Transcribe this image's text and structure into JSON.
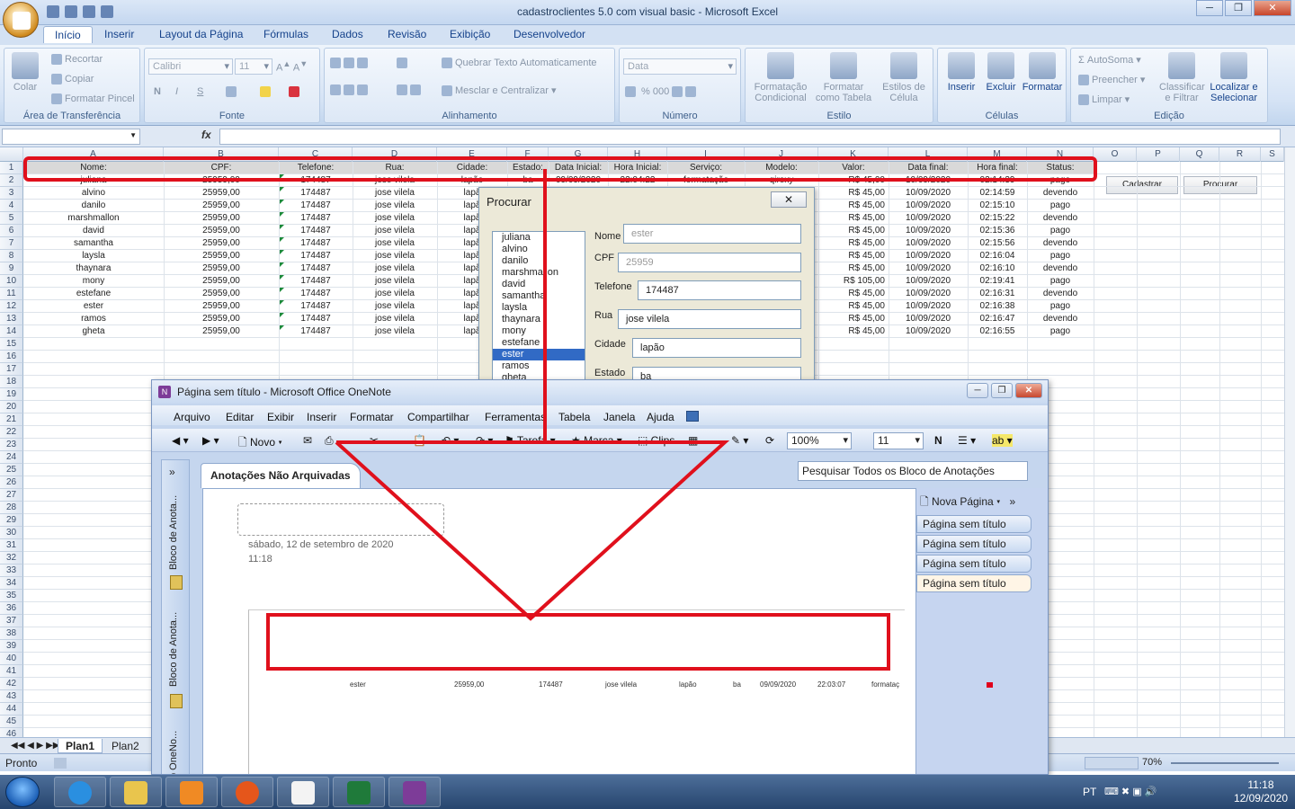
{
  "excel": {
    "window_title": "cadastroclientes 5.0 com visual basic - Microsoft Excel",
    "orb_letter": "",
    "window_buttons": [
      "─",
      "❐",
      "✕"
    ],
    "tabs": [
      "Início",
      "Inserir",
      "Layout da Página",
      "Fórmulas",
      "Dados",
      "Revisão",
      "Exibição",
      "Desenvolvedor"
    ],
    "ribbon": {
      "clipboard": {
        "label": "Área de Transferência",
        "paste": "Colar",
        "cut": "Recortar",
        "copy": "Copiar",
        "format_painter": "Formatar Pincel"
      },
      "font": {
        "label": "Fonte",
        "name": "Calibri",
        "size": "11",
        "bold": "N",
        "italic": "I",
        "underline": "S"
      },
      "alignment": {
        "label": "Alinhamento",
        "wrap": "Quebrar Texto Automaticamente",
        "merge": "Mesclar e Centralizar"
      },
      "number": {
        "label": "Número",
        "format": "Data"
      },
      "styles": {
        "label": "Estilo",
        "conditional": "Formatação Condicional",
        "as_table": "Formatar como Tabela",
        "cell_styles": "Estilos de Célula"
      },
      "cells": {
        "label": "Células",
        "insert": "Inserir",
        "delete": "Excluir",
        "format": "Formatar"
      },
      "editing": {
        "label": "Edição",
        "autosum": "AutoSoma",
        "fill": "Preencher",
        "clear": "Limpar",
        "sort": "Classificar e Filtrar",
        "find": "Localizar e Selecionar"
      }
    },
    "formula_bar": {
      "fx": "fx",
      "name_box": "",
      "content": ""
    },
    "columns": [
      "A",
      "B",
      "C",
      "D",
      "E",
      "F",
      "G",
      "H",
      "I",
      "J",
      "K",
      "L",
      "M",
      "N",
      "O",
      "P",
      "Q",
      "R",
      "S"
    ],
    "row_numbers": [
      "1",
      "2",
      "3",
      "4",
      "5",
      "6",
      "7",
      "8",
      "9",
      "10",
      "11",
      "12",
      "13",
      "14",
      "15",
      "16",
      "17",
      "18",
      "19",
      "20",
      "21",
      "22",
      "23",
      "24",
      "25",
      "26",
      "27",
      "28",
      "29",
      "30",
      "31",
      "32",
      "33",
      "34",
      "35",
      "36",
      "37",
      "38",
      "39",
      "40",
      "41",
      "42",
      "43",
      "44",
      "45",
      "46"
    ],
    "headers": [
      "Nome:",
      "CPF:",
      "Telefone:",
      "Rua:",
      "Cidade:",
      "Estado:",
      "Data Inicial:",
      "Hora Inicial:",
      "Serviço:",
      "Modelo:",
      "Valor:",
      "Data final:",
      "Hora final:",
      "Status:"
    ],
    "rows": [
      {
        "nome": "juliana",
        "cpf": "25959,00",
        "tel": "174487",
        "rua": "jose vilela",
        "cidade": "lapão",
        "estado": "ba",
        "dini": "09/09/2020",
        "hini": "22:04:22",
        "serv": "formatação",
        "mod": "qirexy",
        "valor": "R$ 45,00",
        "dfim": "10/09/2020",
        "hfim": "02:14:39",
        "status": "pago"
      },
      {
        "nome": "alvino",
        "cpf": "25959,00",
        "tel": "174487",
        "rua": "jose vilela",
        "cidade": "lapã",
        "estado": "",
        "dini": "",
        "hini": "",
        "serv": "",
        "mod": "",
        "valor": "R$ 45,00",
        "dfim": "10/09/2020",
        "hfim": "02:14:59",
        "status": "devendo"
      },
      {
        "nome": "danilo",
        "cpf": "25959,00",
        "tel": "174487",
        "rua": "jose vilela",
        "cidade": "lapã",
        "estado": "",
        "dini": "",
        "hini": "",
        "serv": "",
        "mod": "",
        "valor": "R$ 45,00",
        "dfim": "10/09/2020",
        "hfim": "02:15:10",
        "status": "pago"
      },
      {
        "nome": "marshmallon",
        "cpf": "25959,00",
        "tel": "174487",
        "rua": "jose vilela",
        "cidade": "lapã",
        "estado": "",
        "dini": "",
        "hini": "",
        "serv": "",
        "mod": "",
        "valor": "R$ 45,00",
        "dfim": "10/09/2020",
        "hfim": "02:15:22",
        "status": "devendo"
      },
      {
        "nome": "david",
        "cpf": "25959,00",
        "tel": "174487",
        "rua": "jose vilela",
        "cidade": "lapã",
        "estado": "",
        "dini": "",
        "hini": "",
        "serv": "",
        "mod": "",
        "valor": "R$ 45,00",
        "dfim": "10/09/2020",
        "hfim": "02:15:36",
        "status": "pago"
      },
      {
        "nome": "samantha",
        "cpf": "25959,00",
        "tel": "174487",
        "rua": "jose vilela",
        "cidade": "lapã",
        "estado": "",
        "dini": "",
        "hini": "",
        "serv": "",
        "mod": "",
        "valor": "R$ 45,00",
        "dfim": "10/09/2020",
        "hfim": "02:15:56",
        "status": "devendo"
      },
      {
        "nome": "laysla",
        "cpf": "25959,00",
        "tel": "174487",
        "rua": "jose vilela",
        "cidade": "lapã",
        "estado": "",
        "dini": "",
        "hini": "",
        "serv": "",
        "mod": "",
        "valor": "R$ 45,00",
        "dfim": "10/09/2020",
        "hfim": "02:16:04",
        "status": "pago"
      },
      {
        "nome": "thaynara",
        "cpf": "25959,00",
        "tel": "174487",
        "rua": "jose vilela",
        "cidade": "lapã",
        "estado": "",
        "dini": "",
        "hini": "",
        "serv": "",
        "mod": "",
        "valor": "R$ 45,00",
        "dfim": "10/09/2020",
        "hfim": "02:16:10",
        "status": "devendo"
      },
      {
        "nome": "mony",
        "cpf": "25959,00",
        "tel": "174487",
        "rua": "jose vilela",
        "cidade": "lapã",
        "estado": "",
        "dini": "",
        "hini": "",
        "serv": "",
        "mod": "",
        "valor": "R$ 105,00",
        "dfim": "10/09/2020",
        "hfim": "02:19:41",
        "status": "pago"
      },
      {
        "nome": "estefane",
        "cpf": "25959,00",
        "tel": "174487",
        "rua": "jose vilela",
        "cidade": "lapã",
        "estado": "",
        "dini": "",
        "hini": "",
        "serv": "",
        "mod": "",
        "valor": "R$ 45,00",
        "dfim": "10/09/2020",
        "hfim": "02:16:31",
        "status": "devendo"
      },
      {
        "nome": "ester",
        "cpf": "25959,00",
        "tel": "174487",
        "rua": "jose vilela",
        "cidade": "lapã",
        "estado": "",
        "dini": "",
        "hini": "",
        "serv": "",
        "mod": "",
        "valor": "R$ 45,00",
        "dfim": "10/09/2020",
        "hfim": "02:16:38",
        "status": "pago"
      },
      {
        "nome": "ramos",
        "cpf": "25959,00",
        "tel": "174487",
        "rua": "jose vilela",
        "cidade": "lapã",
        "estado": "",
        "dini": "",
        "hini": "",
        "serv": "",
        "mod": "",
        "valor": "R$ 45,00",
        "dfim": "10/09/2020",
        "hfim": "02:16:47",
        "status": "devendo"
      },
      {
        "nome": "gheta",
        "cpf": "25959,00",
        "tel": "174487",
        "rua": "jose vilela",
        "cidade": "lapã",
        "estado": "",
        "dini": "",
        "hini": "",
        "serv": "",
        "mod": "",
        "valor": "R$ 45,00",
        "dfim": "10/09/2020",
        "hfim": "02:16:55",
        "status": "pago"
      }
    ],
    "sheet_buttons": {
      "cadastrar": "Cadastrar",
      "procurar": "Procurar"
    },
    "sheet_tabs": [
      "Plan1",
      "Plan2"
    ],
    "status": "Pronto",
    "zoom": "70%"
  },
  "procurar": {
    "title": "Procurar",
    "close": "✕",
    "list": [
      "juliana",
      "alvino",
      "danilo",
      "marshmallon",
      "david",
      "samantha",
      "laysla",
      "thaynara",
      "mony",
      "estefane",
      "ester",
      "ramos",
      "gheta"
    ],
    "selected_index": 10,
    "fields": {
      "nome": {
        "label": "Nome",
        "value": "ester"
      },
      "cpf": {
        "label": "CPF",
        "value": "25959"
      },
      "telefone": {
        "label": "Telefone",
        "value": "174487"
      },
      "rua": {
        "label": "Rua",
        "value": "jose vilela"
      },
      "cidade": {
        "label": "Cidade",
        "value": "lapão"
      },
      "estado": {
        "label": "Estado",
        "value": "ba"
      }
    }
  },
  "onenote": {
    "window_title": "Página sem título - Microsoft Office OneNote",
    "menu": [
      "Arquivo",
      "Editar",
      "Exibir",
      "Inserir",
      "Formatar",
      "Compartilhar",
      "Ferramentas",
      "Tabela",
      "Janela",
      "Ajuda"
    ],
    "toolbar": {
      "new": "Novo",
      "task": "Tarefa",
      "mark": "Marca",
      "clips": "Clips",
      "zoom": "100%",
      "font_size": "11",
      "bold": "N"
    },
    "side_tabs": [
      "Bloco de Anota...",
      "Bloco de Anota...",
      "o OneNo..."
    ],
    "section_tab": "Anotações Não Arquivadas",
    "search_placeholder": "Pesquisar Todos os Bloco de Anotações",
    "date": "sábado, 12 de setembro  de 2020",
    "time": "11:18",
    "pasted_row": [
      "ester",
      "25959,00",
      "174487",
      "jose vilela",
      "lapão",
      "ba",
      "09/09/2020",
      "22:03:07",
      "formataç"
    ],
    "new_page": "Nova Página",
    "pages": [
      "Página sem título",
      "Página sem título",
      "Página sem título",
      "Página sem título"
    ]
  },
  "taskbar": {
    "lang": "PT",
    "time": "11:18",
    "date": "12/09/2020"
  }
}
